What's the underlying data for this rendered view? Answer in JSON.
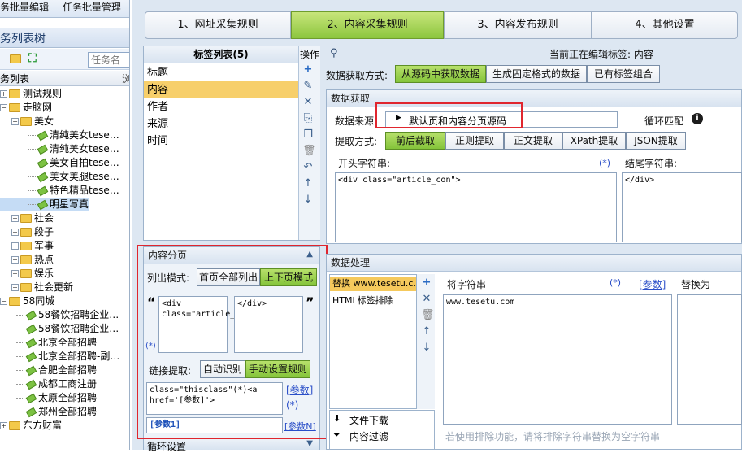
{
  "top_menu": {
    "item1": "务批量编辑",
    "item2": "任务批量管理"
  },
  "task_tree": {
    "title": "务列表树",
    "search_placeholder": "任务名",
    "column_header": "务列表",
    "nodes": [
      {
        "label": "测试规则",
        "level": 0,
        "kind": "folder",
        "expander": "+"
      },
      {
        "label": "走脑网",
        "level": 0,
        "kind": "folder",
        "expander": "−"
      },
      {
        "label": "美女",
        "level": 1,
        "kind": "folder",
        "expander": "−"
      },
      {
        "label": "清纯美女tese…",
        "level": 2,
        "kind": "task"
      },
      {
        "label": "清纯美女tese…",
        "level": 2,
        "kind": "task"
      },
      {
        "label": "美女自拍tese…",
        "level": 2,
        "kind": "task"
      },
      {
        "label": "美女美腿tese…",
        "level": 2,
        "kind": "task"
      },
      {
        "label": "特色精品tese…",
        "level": 2,
        "kind": "task"
      },
      {
        "label": "明星写真",
        "level": 2,
        "kind": "task",
        "selected": true
      },
      {
        "label": "社会",
        "level": 1,
        "kind": "folder",
        "expander": "+"
      },
      {
        "label": "段子",
        "level": 1,
        "kind": "folder",
        "expander": "+"
      },
      {
        "label": "军事",
        "level": 1,
        "kind": "folder",
        "expander": "+"
      },
      {
        "label": "热点",
        "level": 1,
        "kind": "folder",
        "expander": "+"
      },
      {
        "label": "娱乐",
        "level": 1,
        "kind": "folder",
        "expander": "+"
      },
      {
        "label": "社会更新",
        "level": 1,
        "kind": "folder",
        "expander": "+"
      },
      {
        "label": "58同城",
        "level": 0,
        "kind": "folder",
        "expander": "−"
      },
      {
        "label": "58餐饮招聘企业…",
        "level": 1,
        "kind": "task"
      },
      {
        "label": "58餐饮招聘企业…",
        "level": 1,
        "kind": "task"
      },
      {
        "label": "北京全部招聘",
        "level": 1,
        "kind": "task"
      },
      {
        "label": "北京全部招聘-副…",
        "level": 1,
        "kind": "task"
      },
      {
        "label": "合肥全部招聘",
        "level": 1,
        "kind": "task"
      },
      {
        "label": "成都工商注册",
        "level": 1,
        "kind": "task"
      },
      {
        "label": "太原全部招聘",
        "level": 1,
        "kind": "task"
      },
      {
        "label": "郑州全部招聘",
        "level": 1,
        "kind": "task"
      },
      {
        "label": "东方财富",
        "level": 0,
        "kind": "folder",
        "expander": "+"
      }
    ]
  },
  "wizard": {
    "steps": [
      "1、网址采集规则",
      "2、内容采集规则",
      "3、内容发布规则",
      "4、其他设置"
    ],
    "active_index": 1
  },
  "tag_list": {
    "header": "标签列表(5)",
    "ops_header": "操作",
    "items": [
      "标题",
      "内容",
      "作者",
      "来源",
      "时间"
    ],
    "selected_index": 1
  },
  "editing": {
    "label": "当前正在编辑标签: 内容"
  },
  "acquire_mode": {
    "label": "数据获取方式:",
    "options": [
      "从源码中获取数据",
      "生成固定格式的数据",
      "已有标签组合"
    ],
    "active_index": 0
  },
  "data_fetch": {
    "section_title": "数据获取",
    "source_label": "数据来源:",
    "source_value": "默认页和内容分页源码",
    "loop_match_label": "循环匹配",
    "method_label": "提取方式:",
    "methods": [
      "前后截取",
      "正则提取",
      "正文提取",
      "XPath提取",
      "JSON提取"
    ],
    "method_active": 0,
    "start_label": "开头字符串:",
    "start_marker": "(*)",
    "start_value": "<div class=\"article_con\">",
    "end_label": "结尾字符串:",
    "end_value": "</div>"
  },
  "pagination": {
    "title": "内容分页",
    "list_mode_label": "列出模式:",
    "list_modes": [
      "首页全部列出",
      "上下页模式"
    ],
    "list_mode_active": 1,
    "start_value": "<div class=\"article_page\">",
    "end_value": "</div>",
    "quote_open": "“",
    "quote_close": "”",
    "dash": "-",
    "star_marker": "(*)",
    "link_label": "链接提取:",
    "link_modes": [
      "自动识别",
      "手动设置规则"
    ],
    "link_mode_active": 1,
    "link_rule": "class=\"thisclass\"(*)<a href='[参数]'>",
    "param_link": "[参数]",
    "param_star": "(*)",
    "param_value": "[参数1]",
    "param_n": "[参数N]",
    "loop_settings": "循环设置"
  },
  "processing": {
    "section_title": "数据处理",
    "rules": [
      "替换 www.tesetu.c…",
      "HTML标签排除"
    ],
    "actions": [
      "文件下载",
      "内容过滤"
    ],
    "replace_from_label": "将字符串",
    "star_link": "(*)",
    "param_link": "[参数]",
    "replace_to_label": "替换为",
    "replace_from_value": "www.tesetu.com",
    "hint": "若使用排除功能，请将排除字符串替换为空字符串"
  }
}
